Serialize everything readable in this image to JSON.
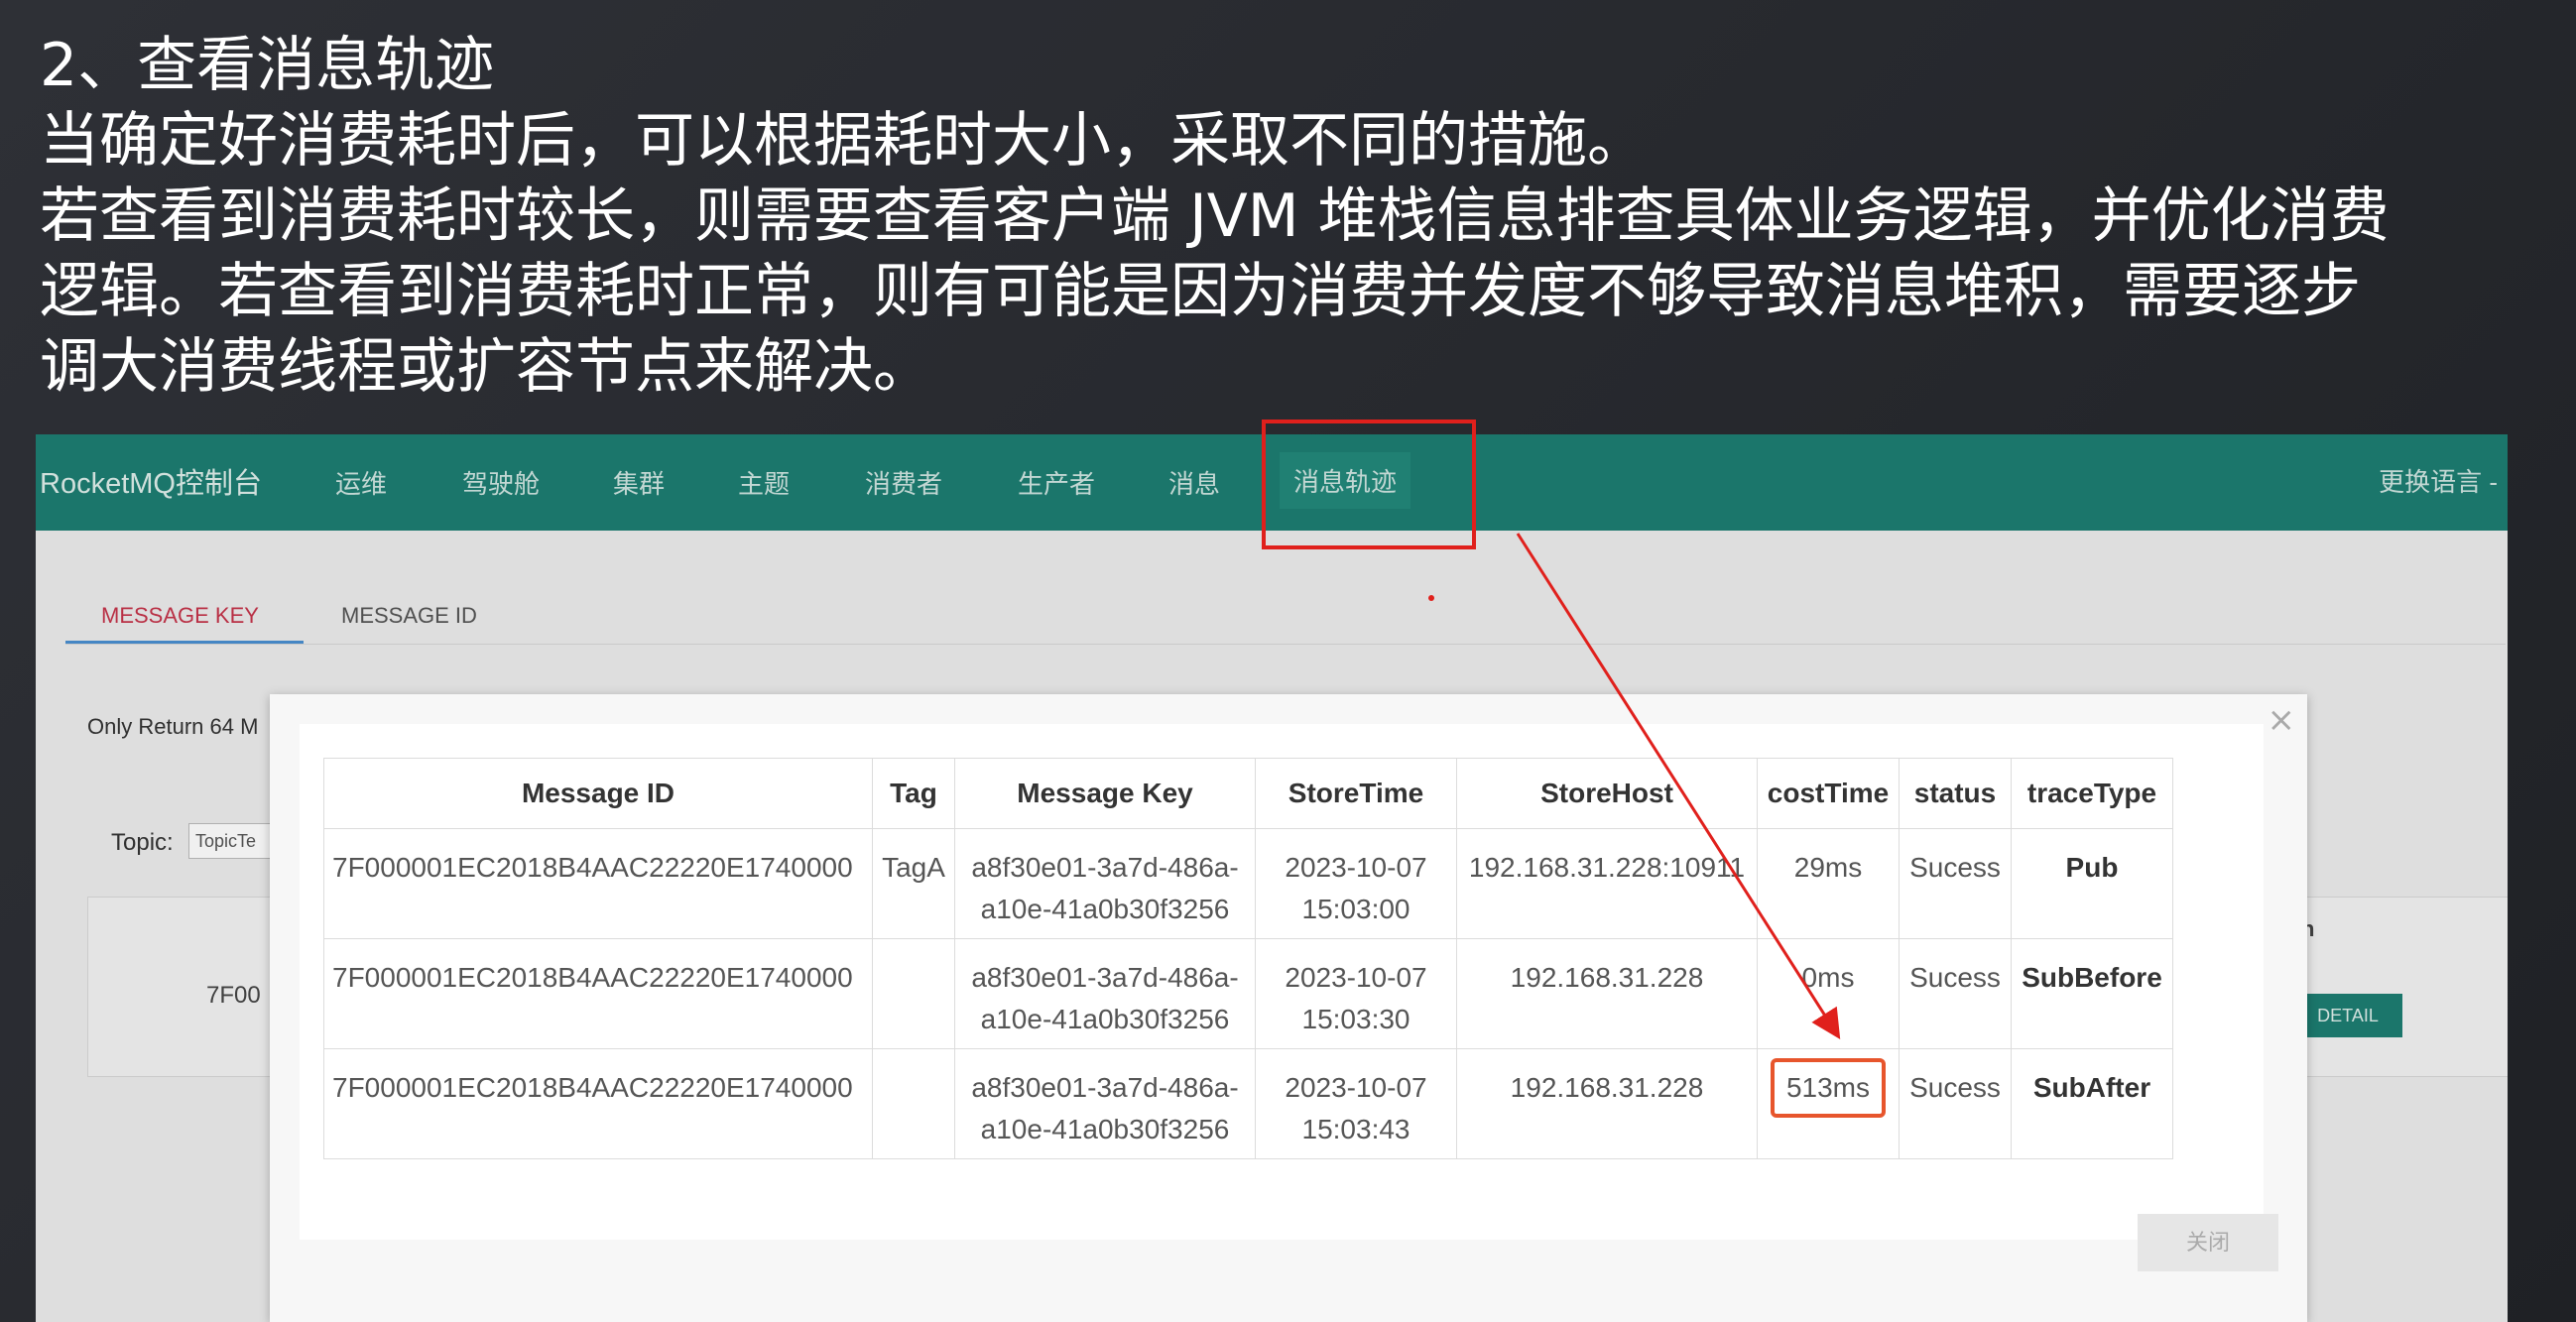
{
  "slide": {
    "line1": "2、查看消息轨迹",
    "line2": "当确定好消费耗时后，可以根据耗时大小，采取不同的措施。",
    "line3": "若查看到消费耗时较长，则需要查看客户端 JVM 堆栈信息排查具体业务逻辑，并优化消费",
    "line4": "逻辑。若查看到消费耗时正常，则有可能是因为消费并发度不够导致消息堆积，需要逐步",
    "line5": "调大消费线程或扩容节点来解决。"
  },
  "navbar": {
    "brand": "RocketMQ控制台",
    "items": [
      "运维",
      "驾驶舱",
      "集群",
      "主题",
      "消费者",
      "生产者",
      "消息",
      "消息轨迹"
    ],
    "active_item": "消息轨迹",
    "language": "更换语言 -"
  },
  "tabs": {
    "message_key": "MESSAGE KEY",
    "message_id": "MESSAGE ID"
  },
  "background": {
    "note": "Only Return 64 M",
    "topic_label": "Topic:",
    "topic_value": "TopicTe",
    "id_fragment": "7F00",
    "header_fragment": "n",
    "detail_button": "DETAIL"
  },
  "modal": {
    "close_glyph": "×",
    "close_button": "关闭",
    "columns": [
      "Message ID",
      "Tag",
      "Message Key",
      "StoreTime",
      "StoreHost",
      "costTime",
      "status",
      "traceType"
    ],
    "rows": [
      {
        "message_id": "7F000001EC2018B4AAC22220E1740000",
        "tag": "TagA",
        "message_key_1": "a8f30e01-3a7d-486a-",
        "message_key_2": "a10e-41a0b30f3256",
        "store_date": "2023-10-07",
        "store_time": "15:03:00",
        "store_host": "192.168.31.228:10911",
        "cost_time": "29ms",
        "status": "Sucess",
        "trace_type": "Pub"
      },
      {
        "message_id": "7F000001EC2018B4AAC22220E1740000",
        "tag": "",
        "message_key_1": "a8f30e01-3a7d-486a-",
        "message_key_2": "a10e-41a0b30f3256",
        "store_date": "2023-10-07",
        "store_time": "15:03:30",
        "store_host": "192.168.31.228",
        "cost_time": "0ms",
        "status": "Sucess",
        "trace_type": "SubBefore"
      },
      {
        "message_id": "7F000001EC2018B4AAC22220E1740000",
        "tag": "",
        "message_key_1": "a8f30e01-3a7d-486a-",
        "message_key_2": "a10e-41a0b30f3256",
        "store_date": "2023-10-07",
        "store_time": "15:03:43",
        "store_host": "192.168.31.228",
        "cost_time": "513ms",
        "status": "Sucess",
        "trace_type": "SubAfter"
      }
    ]
  },
  "colors": {
    "nav": "#1d7e72",
    "highlight": "#e0201c",
    "cost_highlight": "#e7552c",
    "active_tab": "#c5344a"
  }
}
